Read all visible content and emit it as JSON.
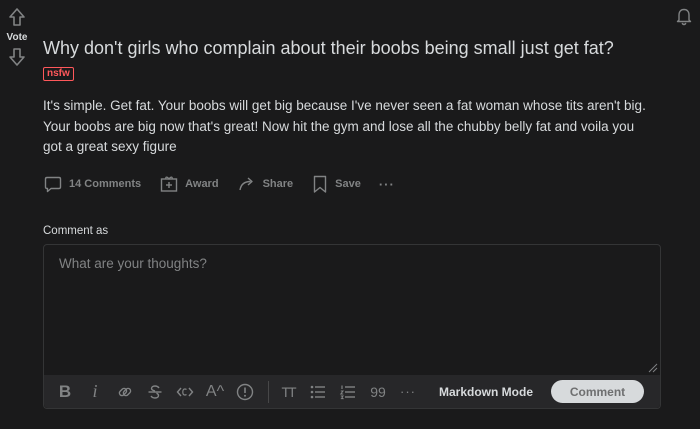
{
  "vote": {
    "label": "Vote"
  },
  "post": {
    "title": "Why don't girls who complain about their boobs being small just get fat?",
    "flair": "nsfw",
    "body_lines": [
      "It's simple. Get fat. Your boobs will get big because I've never seen a fat woman whose tits aren't big.",
      "Your boobs are big now that's great! Now hit the gym and lose all the chubby belly fat and voila you",
      "got a great sexy figure"
    ]
  },
  "actions": {
    "comments": "14 Comments",
    "award": "Award",
    "share": "Share",
    "save": "Save",
    "more": "···"
  },
  "comment_box": {
    "label": "Comment as",
    "placeholder": "What are your thoughts?",
    "markdown_mode": "Markdown Mode",
    "submit": "Comment",
    "toolbar": {
      "bold": "B",
      "italic": "i",
      "superscript": "A^",
      "heading": "TT",
      "quote": "99",
      "more": "···"
    }
  },
  "colors": {
    "background": "#1a1a1b",
    "text": "#d7dadc",
    "muted": "#818384",
    "nsfw": "#ff585b",
    "toolbar": "#272729"
  }
}
